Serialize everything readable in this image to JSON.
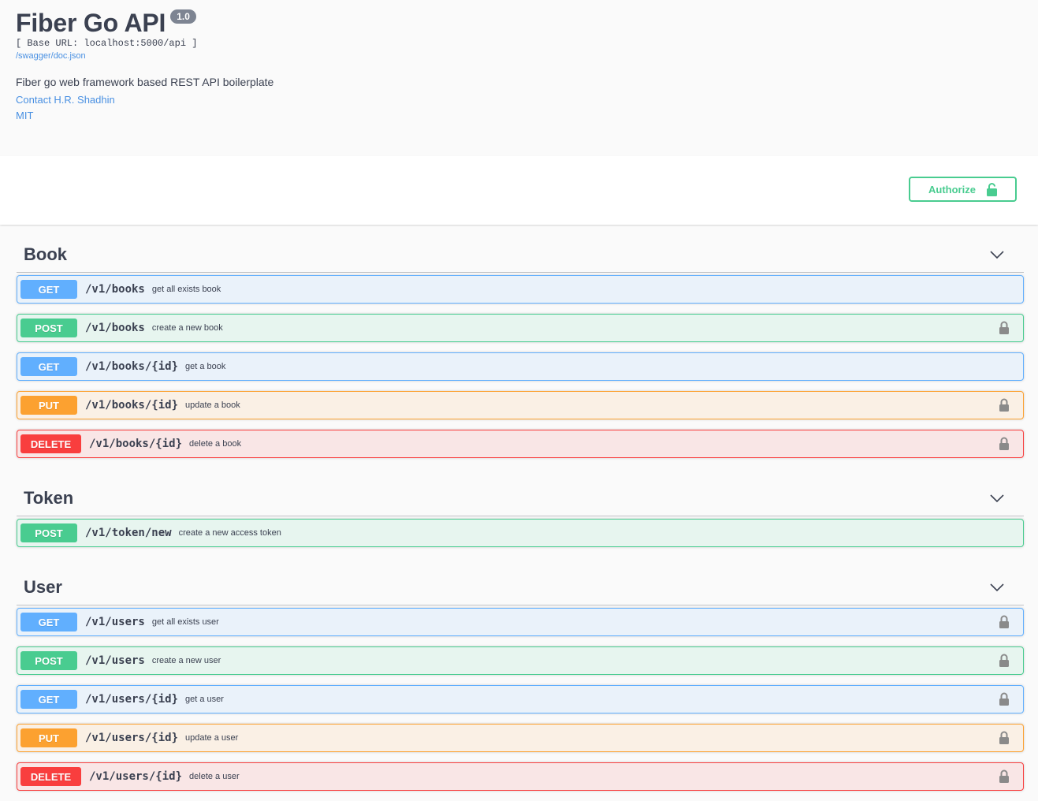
{
  "info": {
    "title": "Fiber Go API",
    "version": "1.0",
    "base_url": "[ Base URL: localhost:5000/api ]",
    "spec_link": "/swagger/doc.json",
    "description": "Fiber go web framework based REST API boilerplate",
    "contact": "Contact H.R. Shadhin",
    "license": "MIT"
  },
  "authorize": {
    "label": "Authorize",
    "icon": "unlocked-icon",
    "color": "#49cc90"
  },
  "colors": {
    "get": "#61affe",
    "post": "#49cc90",
    "put": "#fca130",
    "delete": "#f93e3e"
  },
  "tags": [
    {
      "name": "Book",
      "operations": [
        {
          "method": "GET",
          "path": "/v1/books",
          "summary": "get all exists book",
          "locked": false
        },
        {
          "method": "POST",
          "path": "/v1/books",
          "summary": "create a new book",
          "locked": true
        },
        {
          "method": "GET",
          "path": "/v1/books/{id}",
          "summary": "get a book",
          "locked": false
        },
        {
          "method": "PUT",
          "path": "/v1/books/{id}",
          "summary": "update a book",
          "locked": true
        },
        {
          "method": "DELETE",
          "path": "/v1/books/{id}",
          "summary": "delete a book",
          "locked": true
        }
      ]
    },
    {
      "name": "Token",
      "operations": [
        {
          "method": "POST",
          "path": "/v1/token/new",
          "summary": "create a new access token",
          "locked": false
        }
      ]
    },
    {
      "name": "User",
      "operations": [
        {
          "method": "GET",
          "path": "/v1/users",
          "summary": "get all exists user",
          "locked": true
        },
        {
          "method": "POST",
          "path": "/v1/users",
          "summary": "create a new user",
          "locked": true
        },
        {
          "method": "GET",
          "path": "/v1/users/{id}",
          "summary": "get a user",
          "locked": true
        },
        {
          "method": "PUT",
          "path": "/v1/users/{id}",
          "summary": "update a user",
          "locked": true
        },
        {
          "method": "DELETE",
          "path": "/v1/users/{id}",
          "summary": "delete a user",
          "locked": true
        }
      ]
    }
  ]
}
